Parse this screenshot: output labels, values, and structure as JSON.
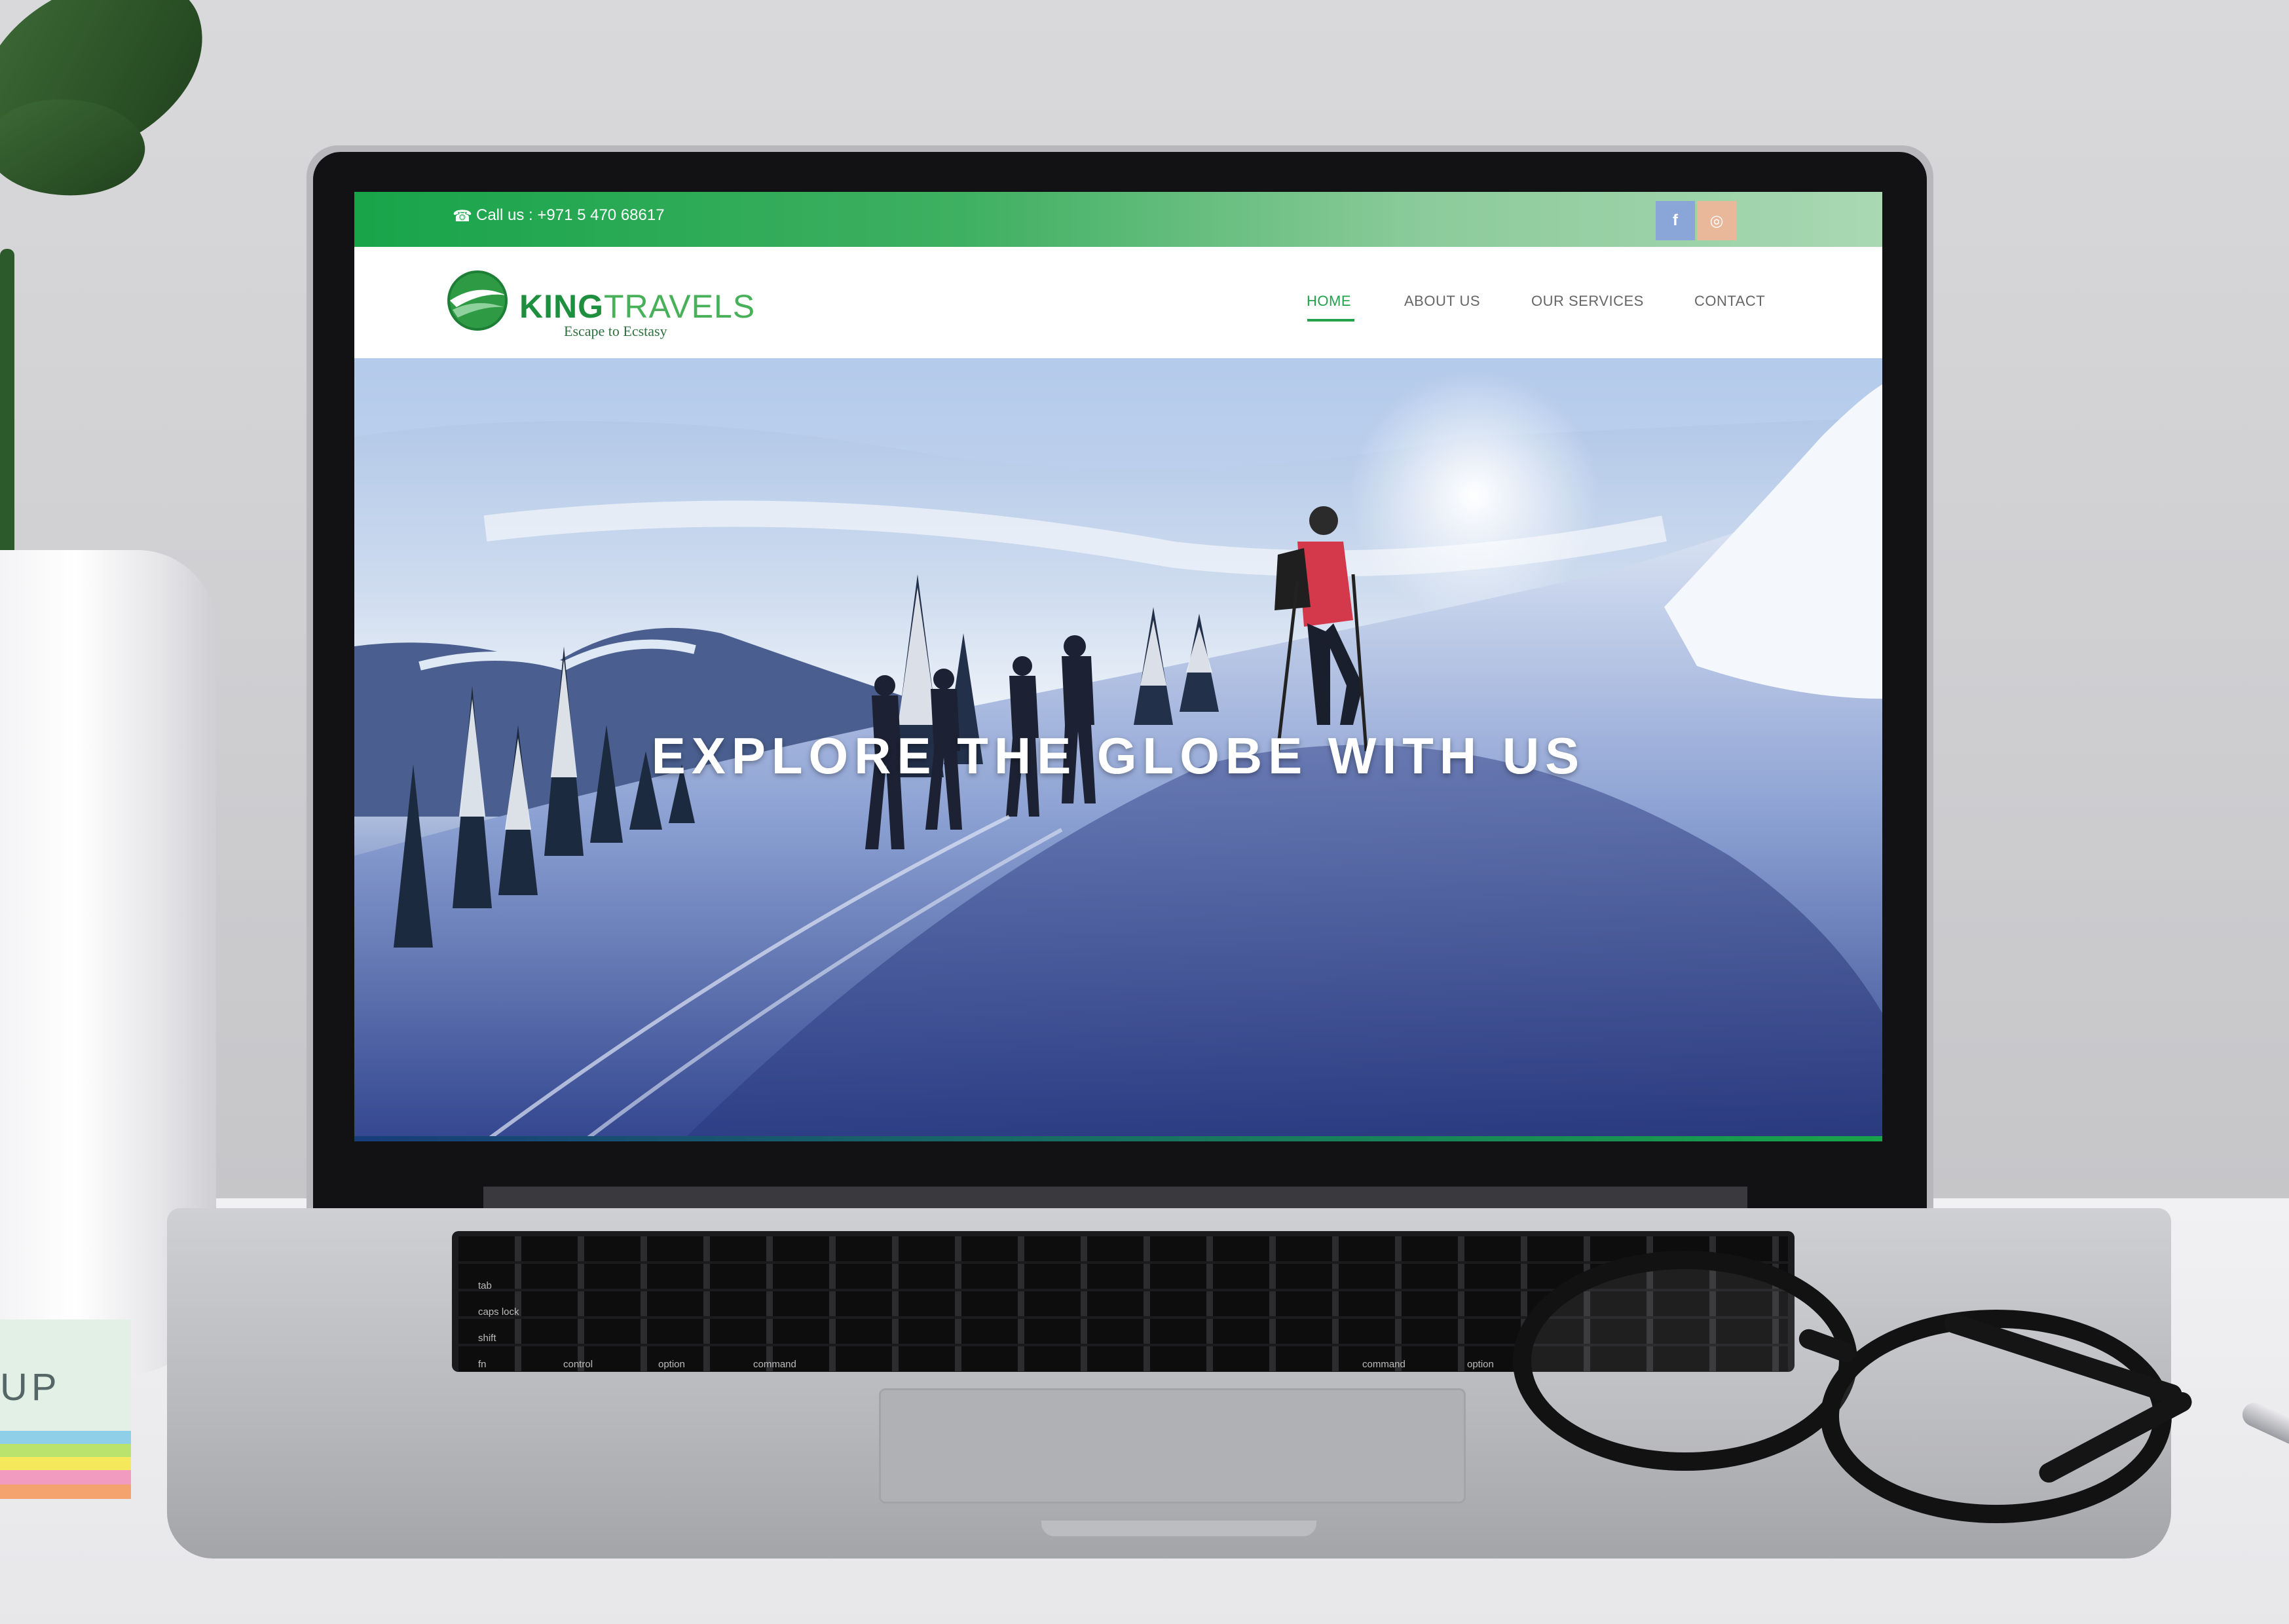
{
  "topbar": {
    "call_label": "Call us : +971 5 470 68617",
    "social": [
      {
        "icon": "facebook-icon",
        "glyph": "f",
        "color": "#8aa6d9"
      },
      {
        "icon": "instagram-icon",
        "glyph": "◎",
        "color": "#e9b79a"
      }
    ],
    "colors": {
      "green": "#18a44a",
      "light_green": "#a9d8b2"
    }
  },
  "header": {
    "brand_king": "KING",
    "brand_travels": "TRAVELS",
    "tagline": "Escape to Ecstasy",
    "nav": [
      {
        "label": "HOME",
        "active": true
      },
      {
        "label": "ABOUT US",
        "active": false
      },
      {
        "label": "OUR SERVICES",
        "active": false
      },
      {
        "label": "CONTACT",
        "active": false
      }
    ],
    "accent": "#22a24a"
  },
  "hero": {
    "headline": "EXPLORE THE GLOBE WITH US"
  },
  "desk": {
    "sticky_note_text": "UP"
  },
  "keyboard": {
    "labels": [
      "tab",
      "caps lock",
      "shift",
      "fn",
      "control",
      "option",
      "command",
      "command",
      "option"
    ]
  }
}
